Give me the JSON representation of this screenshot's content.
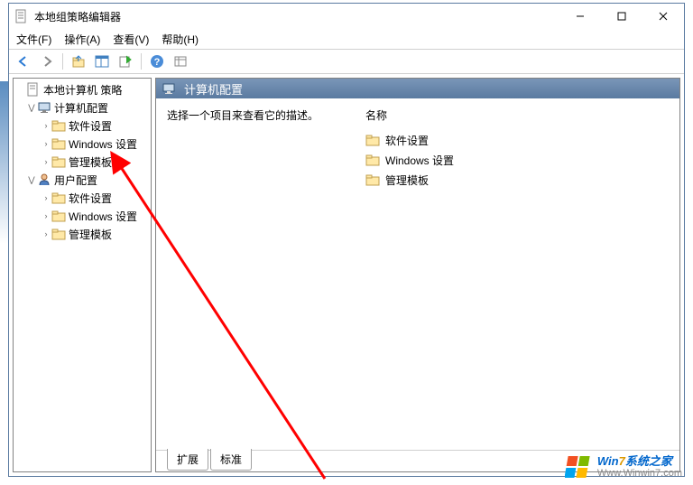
{
  "window": {
    "title": "本地组策略编辑器"
  },
  "menu": {
    "file": "文件(F)",
    "action": "操作(A)",
    "view": "查看(V)",
    "help": "帮助(H)"
  },
  "tree": {
    "root": "本地计算机 策略",
    "computer_config": "计算机配置",
    "computer_children": {
      "software": "软件设置",
      "windows": "Windows 设置",
      "templates": "管理模板"
    },
    "user_config": "用户配置",
    "user_children": {
      "software": "软件设置",
      "windows": "Windows 设置",
      "templates": "管理模板"
    }
  },
  "detail": {
    "header": "计算机配置",
    "description": "选择一个项目来查看它的描述。",
    "column_name": "名称",
    "items": {
      "software": "软件设置",
      "windows": "Windows 设置",
      "templates": "管理模板"
    },
    "tabs": {
      "extended": "扩展",
      "standard": "标准"
    }
  },
  "watermark": {
    "brand_prefix": "Win",
    "brand_seven": "7",
    "brand_suffix": "系统之家",
    "url": "Www.Winwin7.com"
  }
}
